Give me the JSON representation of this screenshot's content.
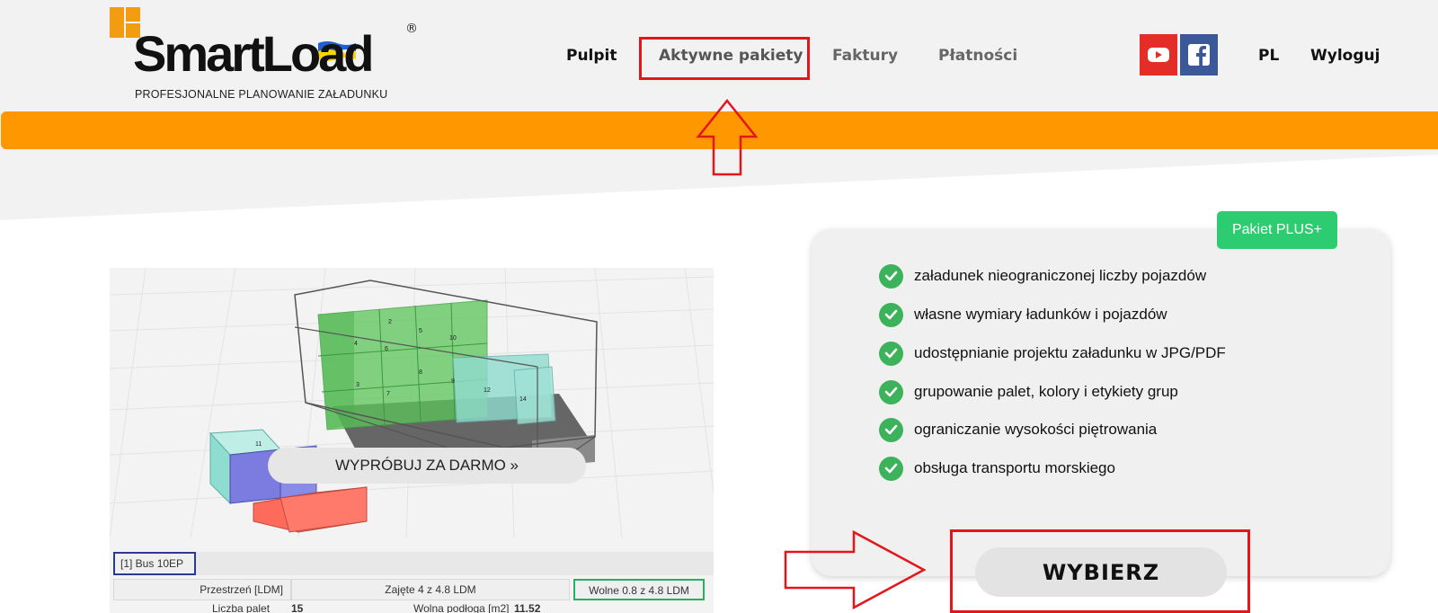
{
  "logo": {
    "wordmark": "SmartLoad",
    "registered": "®",
    "tagline": "PROFESJONALNE PLANOWANIE ZAŁADUNKU"
  },
  "nav": {
    "items": [
      "Pulpit",
      "Aktywne pakiety",
      "Faktury",
      "Płatności"
    ],
    "language": "PL",
    "logout": "Wyloguj",
    "social": [
      "youtube-icon",
      "facebook-icon"
    ]
  },
  "preview": {
    "try_button": "WYPRÓBUJ ZA DARMO »",
    "bus_label": "[1] Bus 10EP",
    "ldm_label": "Przestrzeń [LDM]",
    "ldm_used": "Zajęte 4 z 4.8 LDM",
    "ldm_free": "Wolne 0.8 z 4.8 LDM",
    "pallet_count_label": "Liczba palet",
    "pallet_count": "15",
    "free_floor_label": "Wolna podłoga [m2]",
    "free_floor": "11.52",
    "box_numbers": [
      "2",
      "5",
      "10",
      "4",
      "6",
      "3",
      "7",
      "8",
      "9",
      "12",
      "14",
      "11"
    ]
  },
  "package": {
    "badge": "Pakiet PLUS+",
    "features": [
      "załadunek nieograniczonej liczby pojazdów",
      "własne wymiary ładunków i pojazdów",
      "udostępnianie projektu załadunku w JPG/PDF",
      "grupowanie palet, kolory i etykiety grup",
      "ograniczanie wysokości piętrowania",
      "obsługa transportu morskiego"
    ],
    "choose_button": "WYBIERZ"
  },
  "colors": {
    "brand_orange": "#ff9800",
    "highlight_red": "#e3161b",
    "check_green": "#3cb35a",
    "badge_green": "#2ecc71"
  }
}
